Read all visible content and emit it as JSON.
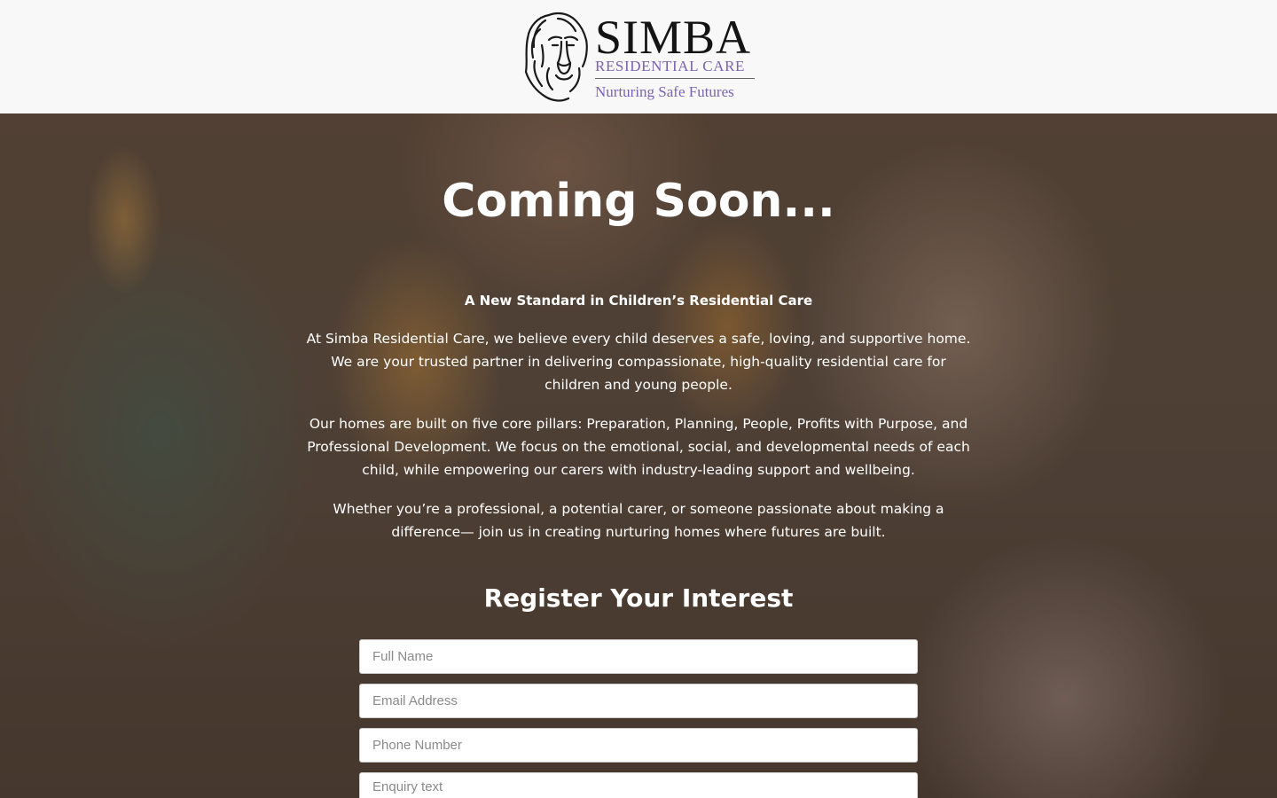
{
  "logo": {
    "icon": "lion-head-icon",
    "name": "SIMBA",
    "subtitle": "RESIDENTIAL CARE",
    "tagline": "Nurturing Safe Futures"
  },
  "hero": {
    "heading": "Coming Soon...",
    "subheading": "A New Standard in Children’s Residential Care",
    "paragraphs": [
      "At Simba Residential Care, we believe every child deserves a safe, loving, and supportive home. We are your trusted partner in delivering compassionate, high-quality residential care for children and young people.",
      "Our homes are built on five core pillars: Preparation, Planning, People, Profits with Purpose, and Professional Development. We focus on the emotional, social, and developmental needs of each child, while empowering our carers with industry-leading support and wellbeing.",
      "Whether you’re a professional, a potential carer, or someone passionate about making a difference— join us in creating nurturing homes where futures are built."
    ]
  },
  "form": {
    "title": "Register Your Interest",
    "full_name_placeholder": "Full Name",
    "email_placeholder": "Email Address",
    "phone_placeholder": "Phone Number",
    "enquiry_placeholder": "Enquiry text"
  },
  "colors": {
    "brand_purple": "#7b62b3",
    "header_bg": "#f8f8f8",
    "text_on_hero": "#ffffff"
  }
}
